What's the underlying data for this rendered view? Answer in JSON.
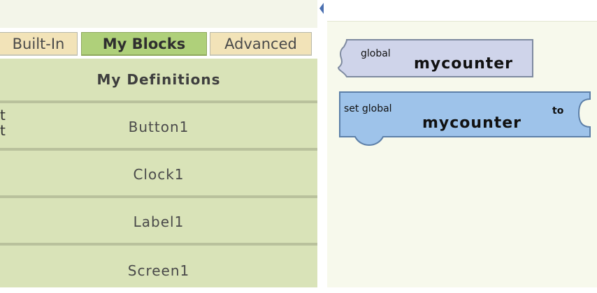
{
  "tabs": [
    {
      "label": "Built-In",
      "active": false
    },
    {
      "label": "My Blocks",
      "active": true
    },
    {
      "label": "Advanced",
      "active": false
    }
  ],
  "drawer": {
    "header": "My Definitions",
    "items": [
      "Button1",
      "Clock1",
      "Label1",
      "Screen1"
    ]
  },
  "cut_text": [
    "t",
    "t"
  ],
  "workspace": {
    "global_block": {
      "prefix": "global",
      "name": "mycounter"
    },
    "set_block": {
      "prefix": "set global",
      "name": "mycounter",
      "suffix": "to"
    }
  },
  "colors": {
    "active_tab": "#afd07a",
    "inactive_tab": "#f2e3b8",
    "drawer_bg": "#d9e3b8",
    "getter_block": "#cfd4ea",
    "setter_block": "#9ec3ea"
  }
}
